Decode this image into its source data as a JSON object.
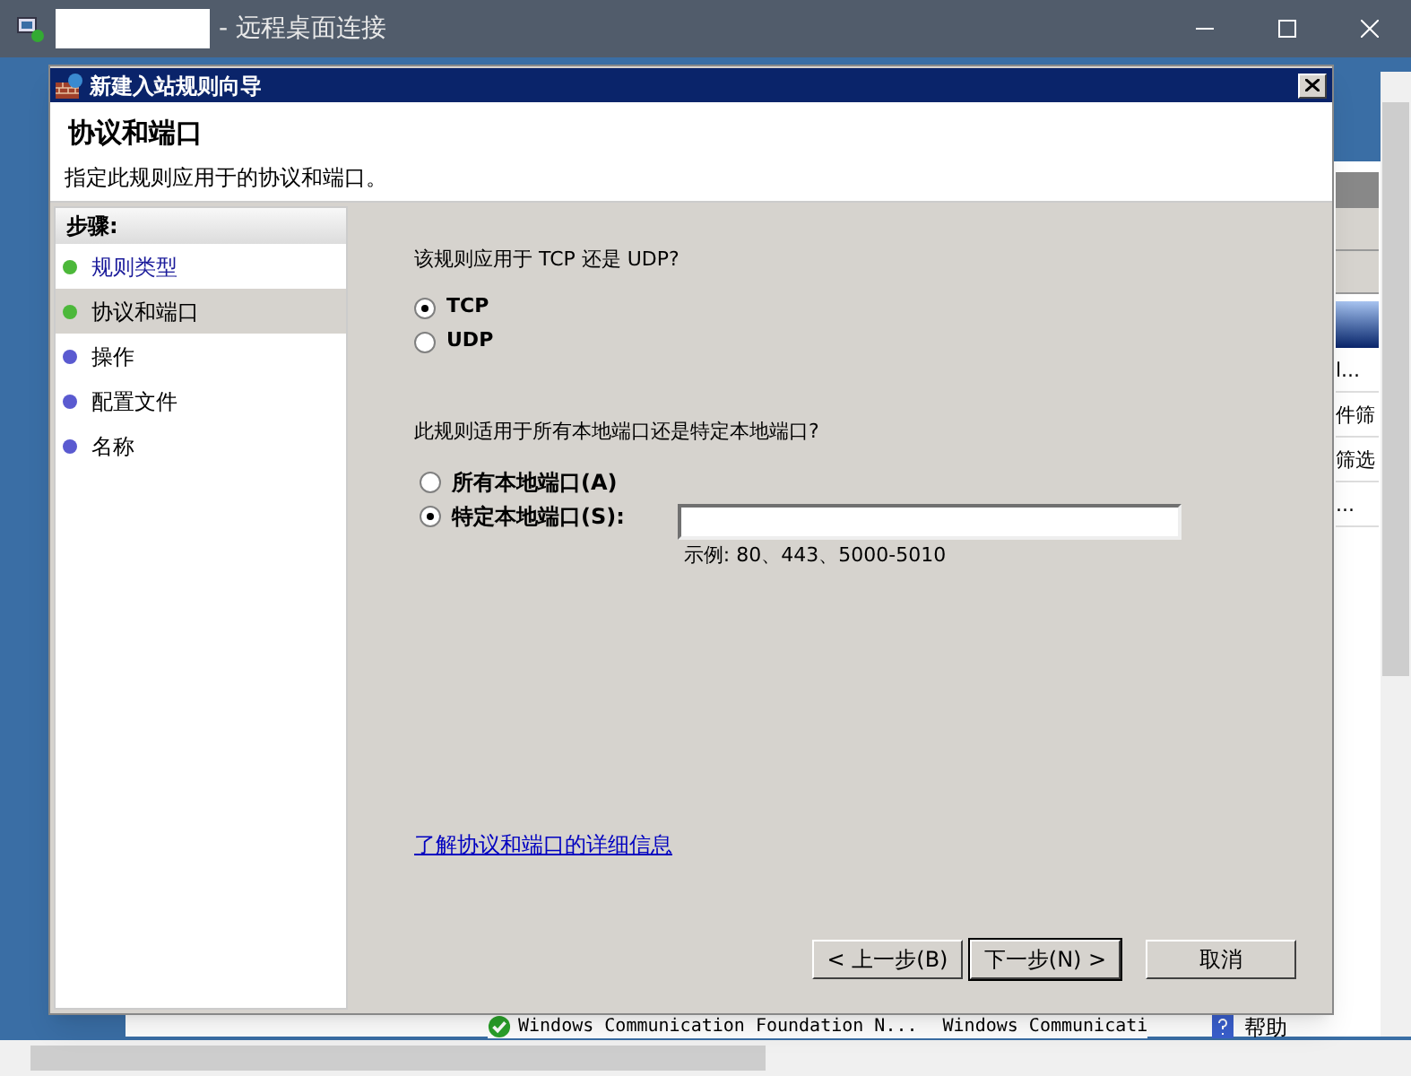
{
  "window": {
    "title": "- 远程桌面连接"
  },
  "background_app": {
    "right_texts": [
      "l...",
      "件筛",
      "筛选",
      "..."
    ],
    "status_row": {
      "name": "Windows Communication Foundation N...",
      "group": "Windows Communicati",
      "help": "帮助"
    }
  },
  "dialog": {
    "title": "新建入站规则向导",
    "heading": "协议和端口",
    "subheading": "指定此规则应用于的协议和端口。",
    "steps_title": "步骤:",
    "steps": [
      {
        "label": "规则类型",
        "kind": "link",
        "color": "#4cb83a",
        "selected": false
      },
      {
        "label": "协议和端口",
        "kind": "plain",
        "color": "#4cb83a",
        "selected": true
      },
      {
        "label": "操作",
        "kind": "plain",
        "color": "#5a5ad0",
        "selected": false
      },
      {
        "label": "配置文件",
        "kind": "plain",
        "color": "#5a5ad0",
        "selected": false
      },
      {
        "label": "名称",
        "kind": "plain",
        "color": "#5a5ad0",
        "selected": false
      }
    ],
    "protocol_question": "该规则应用于 TCP 还是 UDP?",
    "protocols": [
      {
        "label": "TCP",
        "selected": true
      },
      {
        "label": "UDP",
        "selected": false
      }
    ],
    "port_question": "此规则适用于所有本地端口还是特定本地端口?",
    "port_options": [
      {
        "label": "所有本地端口(A)",
        "selected": false
      },
      {
        "label": "特定本地端口(S):",
        "selected": true
      }
    ],
    "port_example": "示例: 80、443、5000-5010",
    "help_link": "了解协议和端口的详细信息",
    "buttons": [
      {
        "label": "< 上一步(B)",
        "default": false
      },
      {
        "label": "下一步(N) >",
        "default": true
      },
      {
        "label": "取消",
        "default": false
      }
    ]
  }
}
